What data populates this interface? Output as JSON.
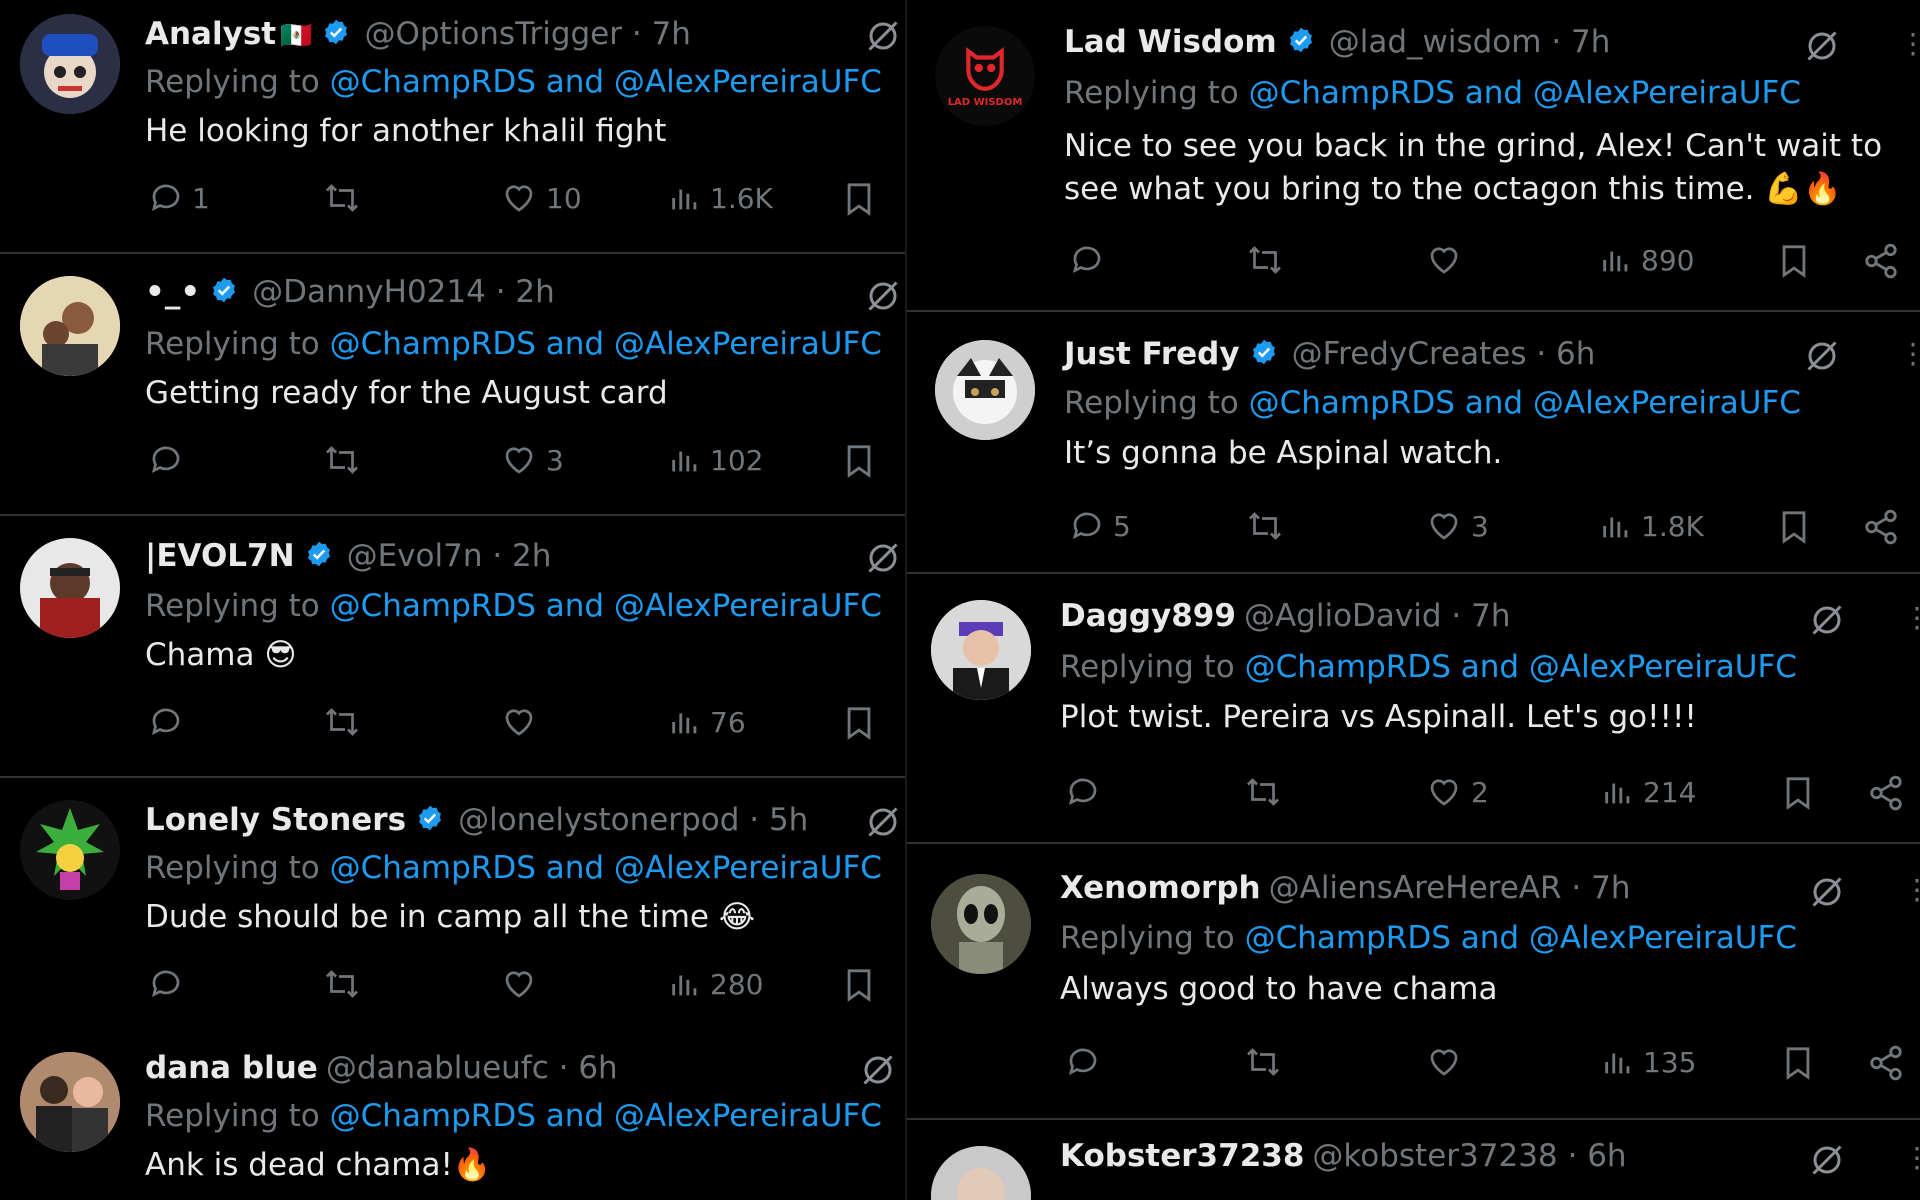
{
  "left": [
    {
      "name": "Analyst",
      "flag": "🇲🇽",
      "verified": true,
      "handle": "@OptionsTrigger",
      "time": "· 7h",
      "replying_prefix": "Replying to",
      "replying_links": "@ChampRDS and @AlexPereiraUFC",
      "text": "He looking for another khalil fight",
      "replies": "1",
      "likes": "10",
      "views": "1.6K"
    },
    {
      "name": "•_•",
      "verified": true,
      "handle": "@DannyH0214",
      "time": "· 2h",
      "replying_prefix": "Replying to",
      "replying_links": "@ChampRDS and @AlexPereiraUFC",
      "text": "Getting ready for the August card",
      "replies": "",
      "likes": "3",
      "views": "102"
    },
    {
      "name": "|EVOL7N",
      "verified": true,
      "handle": "@Evol7n",
      "time": "· 2h",
      "replying_prefix": "Replying to",
      "replying_links": "@ChampRDS and @AlexPereiraUFC",
      "text": "Chama 😎",
      "replies": "",
      "likes": "",
      "views": "76"
    },
    {
      "name": "Lonely Stoners",
      "verified": true,
      "handle": "@lonelystonerpod",
      "time": "· 5h",
      "replying_prefix": "Replying to",
      "replying_links": "@ChampRDS and @AlexPereiraUFC",
      "text": "Dude should be in camp all the time 😂",
      "replies": "",
      "likes": "",
      "views": "280"
    },
    {
      "name": "dana blue",
      "verified": false,
      "handle": "@danablueufc",
      "time": "· 6h",
      "replying_prefix": "Replying to",
      "replying_links": "@ChampRDS and @AlexPereiraUFC",
      "text": "Ank is dead chama!🔥"
    }
  ],
  "right": [
    {
      "name": "Lad Wisdom",
      "verified": true,
      "handle": "@lad_wisdom",
      "time": "· 7h",
      "avatar_text": "LAD WISDOM",
      "replying_prefix": "Replying to",
      "replying_links": "@ChampRDS and @AlexPereiraUFC",
      "text": "Nice to see you back in the grind, Alex! Can't wait to see what you bring to the octagon this time. 💪🔥",
      "replies": "",
      "likes": "",
      "views": "890"
    },
    {
      "name": "Just Fredy",
      "verified": true,
      "handle": "@FredyCreates",
      "time": "· 6h",
      "replying_prefix": "Replying to",
      "replying_links": "@ChampRDS and @AlexPereiraUFC",
      "text": "It’s gonna be Aspinal watch.",
      "replies": "5",
      "likes": "3",
      "views": "1.8K"
    },
    {
      "name": "Daggy899",
      "verified": false,
      "handle": "@AglioDavid",
      "time": "· 7h",
      "replying_prefix": "Replying to",
      "replying_links": "@ChampRDS and @AlexPereiraUFC",
      "text": "Plot twist. Pereira vs Aspinall. Let's go!!!!",
      "replies": "",
      "likes": "2",
      "views": "214"
    },
    {
      "name": "Xenomorph",
      "verified": false,
      "handle": "@AliensAreHereAR",
      "time": "· 7h",
      "replying_prefix": "Replying to",
      "replying_links": "@ChampRDS and @AlexPereiraUFC",
      "text": "Always good to have chama",
      "replies": "",
      "likes": "",
      "views": "135"
    },
    {
      "name": "Kobster37238",
      "verified": false,
      "handle": "@kobster37238",
      "time": "· 6h"
    }
  ],
  "colors": {
    "background": "#000000",
    "text": "#e7e9ea",
    "secondary": "#71767b",
    "link": "#1d9bf0",
    "verified": "#1d9bf0",
    "divider": "#2f3336"
  },
  "icons": [
    "verified-badge-icon",
    "grok-icon",
    "more-icon",
    "reply-icon",
    "retweet-icon",
    "like-icon",
    "views-icon",
    "bookmark-icon",
    "share-icon"
  ]
}
